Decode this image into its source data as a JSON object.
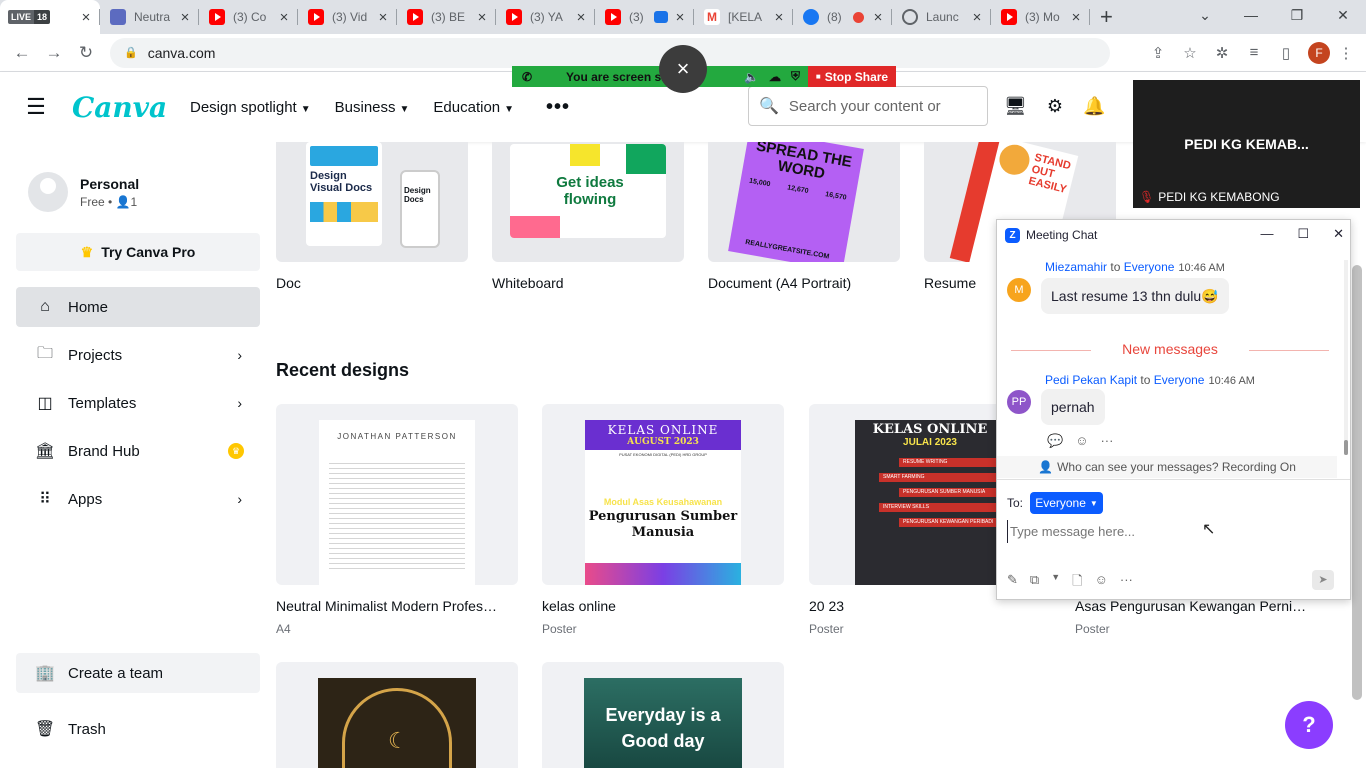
{
  "browser": {
    "live_badge": "LIVE",
    "view_count": "18",
    "tabs": [
      {
        "title": "Neutra",
        "color": "#5c6bc0"
      },
      {
        "title": "(3) Co",
        "color": "#ff0000"
      },
      {
        "title": "(3) Vid",
        "color": "#ff0000"
      },
      {
        "title": "(3) BE",
        "color": "#ff0000"
      },
      {
        "title": "(3) YA",
        "color": "#ff0000"
      },
      {
        "title": "(3)",
        "color": "#ff0000"
      },
      {
        "title": "[KELA",
        "color": "#ea4335"
      },
      {
        "title": "(8)",
        "color": "#1877f2"
      },
      {
        "title": "Launc",
        "color": "#5f6368"
      },
      {
        "title": "(3) Mo",
        "color": "#ff0000"
      }
    ],
    "url": "canva.com",
    "profile_initial": "F"
  },
  "screenshare": {
    "status": "You are screen sh",
    "stop_label": "Stop Share",
    "close_icon": "×"
  },
  "canva": {
    "logo": "Canva",
    "nav": [
      "Design spotlight",
      "Business",
      "Education"
    ],
    "search_placeholder": "Search your content or",
    "account": {
      "name": "Personal",
      "plan": "Free • ",
      "members": "1"
    },
    "try_pro": "Try Canva Pro",
    "sidebar": [
      {
        "label": "Home"
      },
      {
        "label": "Projects"
      },
      {
        "label": "Templates"
      },
      {
        "label": "Brand Hub"
      },
      {
        "label": "Apps"
      }
    ],
    "create_team": "Create a team",
    "trash": "Trash",
    "templates": [
      {
        "label": "Doc",
        "heading": "Design Visual Docs",
        "sub": "Design Docs"
      },
      {
        "label": "Whiteboard",
        "heading": "Get ideas flowing"
      },
      {
        "label": "Document (A4 Portrait)",
        "heading": "SPREAD THE WORD",
        "numbers": [
          "15,000",
          "12,670",
          "16,570"
        ],
        "footer": "REALLYGREATSITE.COM"
      },
      {
        "label": "Resume",
        "heading": "STAND OUT EASILY"
      }
    ],
    "recent_title": "Recent designs",
    "designs": [
      {
        "title": "Neutral Minimalist Modern Profes…",
        "type": "A4",
        "name": "JONATHAN PATTERSON"
      },
      {
        "title": "kelas online",
        "type": "Poster",
        "header": "KELAS ONLINE",
        "month": "AUGUST  2023",
        "org": "PUSAT EKONOMI DIGITAL (PEDI) HRD GROUP",
        "module": "Modul Asas Keusahawanan",
        "body": "Pengurusan Sumber Manusia"
      },
      {
        "title": "20 23",
        "type": "Poster",
        "header": "KELAS ONLINE",
        "month": "JULAI 2023",
        "items": [
          "RESUME WRITING",
          "SMART FARMING",
          "PENGURUSAN SUMBER MANUSIA",
          "INTERVIEW SKILLS",
          "PENGURUSAN KEWANGAN PERIBADI"
        ]
      },
      {
        "title": "Asas Pengurusan Kewangan Perni…",
        "type": "Poster"
      }
    ],
    "design_extra": {
      "everyday": "Everyday is a Good day"
    },
    "help": "?"
  },
  "meeting": {
    "video_name": "PEDI KG KEMAB...",
    "video_label": "PEDI KG KEMABONG",
    "chat_title": "Meeting Chat",
    "messages": [
      {
        "initials": "M",
        "sender": "Miezamahir",
        "to": "to",
        "audience": "Everyone",
        "time": "10:46 AM",
        "text": "Last resume 13 thn dulu😅",
        "color": "#f7a41d"
      },
      {
        "initials": "PP",
        "sender": "Pedi Pekan Kapit",
        "to": "to",
        "audience": "Everyone",
        "time": "10:46 AM",
        "text": "pernah",
        "color": "#8e55c9"
      }
    ],
    "new_messages": "New messages",
    "visibility": "Who can see your messages? Recording On",
    "to_label": "To:",
    "recipient": "Everyone",
    "input_placeholder": "Type message here..."
  }
}
